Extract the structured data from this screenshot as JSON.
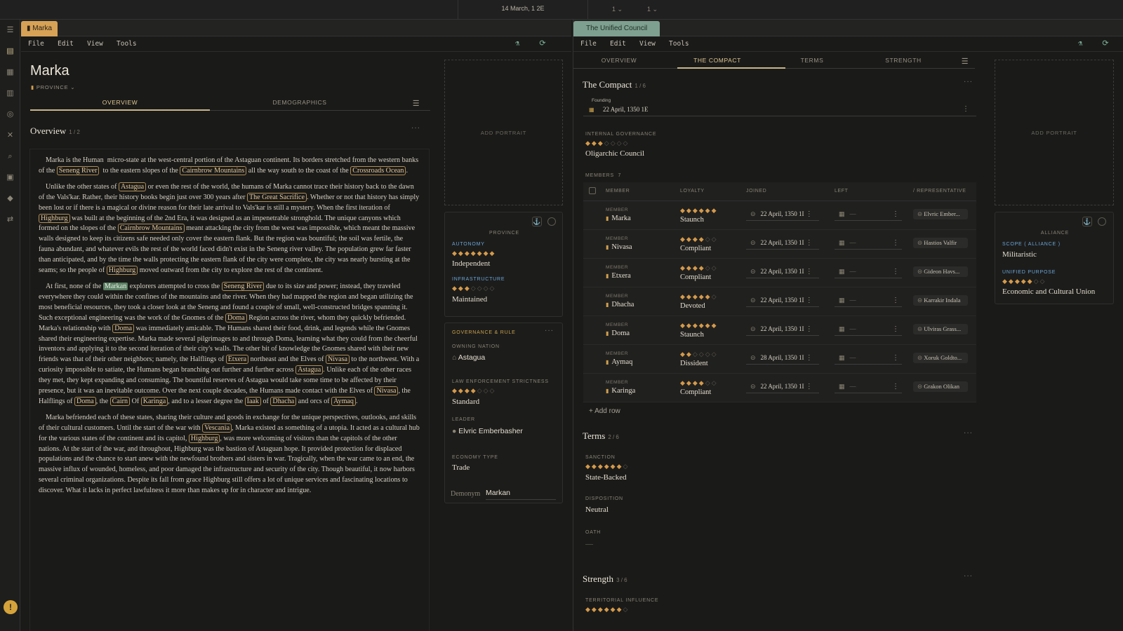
{
  "topbar": {
    "date": "14 March, 1 2E",
    "dd1": "1 ⌄",
    "dd2": "1 ⌄"
  },
  "rail": {
    "icons": [
      "menu-icon",
      "book-icon",
      "calendar-icon",
      "map-icon",
      "globe-icon",
      "tools-icon",
      "search-icon",
      "grid-icon",
      "atlas-icon",
      "swap-icon"
    ],
    "avatar": "!"
  },
  "left": {
    "tab": "Marka",
    "menu": [
      "File",
      "Edit",
      "View",
      "Tools"
    ],
    "title": "Marka",
    "type": "PROVINCE",
    "tabs": [
      "OVERVIEW",
      "DEMOGRAPHICS"
    ],
    "section": {
      "title": "Overview",
      "count": "1 / 2"
    },
    "portrait": "ADD PORTRAIT",
    "province_card": {
      "heading": "PROVINCE",
      "autonomy": {
        "label": "AUTONOMY",
        "value": "Independent",
        "rating": 7,
        "max": 7
      },
      "infrastructure": {
        "label": "INFRASTRUCTURE",
        "value": "Maintained",
        "rating": 3,
        "max": 7
      }
    },
    "governance": {
      "heading": "GOVERNANCE & RULE",
      "owning_label": "OWNING NATION",
      "owning": "Astagua",
      "law_label": "LAW ENFORCEMENT STRICTNESS",
      "law": "Standard",
      "law_rating": 4,
      "law_max": 7,
      "leader_label": "LEADER",
      "leader": "Elvric Emberbasher",
      "economy_label": "ECONOMY TYPE",
      "economy": "Trade",
      "demonym_label": "Demonym",
      "demonym": "Markan"
    }
  },
  "right": {
    "tab": "The Unified Council",
    "menu": [
      "File",
      "Edit",
      "View",
      "Tools"
    ],
    "tabs": [
      "OVERVIEW",
      "THE COMPACT",
      "TERMS",
      "STRENGTH"
    ],
    "compact": {
      "title": "The Compact",
      "count": "1 / 6",
      "founding_label": "Founding",
      "founding": "22 April, 1350 1E",
      "gov_label": "INTERNAL GOVERNANCE",
      "gov": "Oligarchic Council",
      "gov_rating": 3,
      "gov_max": 7,
      "members_label": "MEMBERS",
      "members_count": "7",
      "cols": [
        "MEMBER",
        "LOYALTY",
        "JOINED",
        "LEFT",
        "/ REPRESENTATIVE"
      ],
      "row_key": "MEMBER",
      "members": [
        {
          "name": "Marka",
          "loyalty": "Staunch",
          "rating": 6,
          "joined": "22 April, 1350 1I",
          "left": "—",
          "rep": "Elvric Ember..."
        },
        {
          "name": "Nivasa",
          "loyalty": "Compliant",
          "rating": 4,
          "joined": "22 April, 1350 1I",
          "left": "—",
          "rep": "Hastios Valfir"
        },
        {
          "name": "Etxera",
          "loyalty": "Compliant",
          "rating": 4,
          "joined": "22 April, 1350 1I",
          "left": "—",
          "rep": "Gideon Havs..."
        },
        {
          "name": "Dhacha",
          "loyalty": "Devoted",
          "rating": 5,
          "joined": "22 April, 1350 1I",
          "left": "—",
          "rep": "Karrakir Indala"
        },
        {
          "name": "Doma",
          "loyalty": "Staunch",
          "rating": 6,
          "joined": "22 April, 1350 1I",
          "left": "—",
          "rep": "Ulviras Grass..."
        },
        {
          "name": "Aymaq",
          "loyalty": "Dissident",
          "rating": 2,
          "joined": "28 April, 1350 1I",
          "left": "—",
          "rep": "Xoruk Goldto..."
        },
        {
          "name": "Karinga",
          "loyalty": "Compliant",
          "rating": 4,
          "joined": "22 April, 1350 1I",
          "left": "—",
          "rep": "Grakon Olikan"
        }
      ],
      "add_row": "+ Add row"
    },
    "terms": {
      "title": "Terms",
      "count": "2 / 6",
      "sanction_label": "SANCTION",
      "sanction": "State-Backed",
      "sanction_rating": 6,
      "sanction_max": 7,
      "disposition_label": "DISPOSITION",
      "disposition": "Neutral",
      "oath_label": "OATH",
      "oath": "—"
    },
    "strength": {
      "title": "Strength",
      "count": "3 / 6",
      "terr_label": "TERRITORIAL INFLUENCE",
      "terr_rating": 6,
      "terr_max": 7
    },
    "portrait": "ADD PORTRAIT",
    "alliance": {
      "heading": "ALLIANCE",
      "scope_label": "SCOPE ( ALLIANCE )",
      "scope": "Militaristic",
      "purpose_label": "UNIFIED PURPOSE",
      "purpose": "Economic and Cultural Union",
      "purpose_rating": 5,
      "purpose_max": 7
    }
  },
  "colors": {
    "accent": "#d7a256",
    "council": "#7ea090",
    "star": "#d59a4a",
    "link_blue": "#6aa6d6"
  }
}
